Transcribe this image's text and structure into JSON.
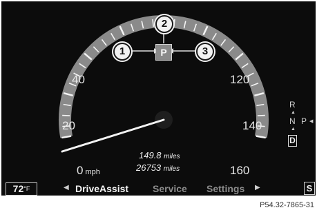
{
  "speedometer": {
    "labels": {
      "s0": "0",
      "s20": "20",
      "s40": "40",
      "s120": "120",
      "s140": "140",
      "s160": "160"
    },
    "unit": "mph",
    "needle_speed_mph": 2
  },
  "trip": {
    "trip_value": "149.8",
    "trip_unit": "miles",
    "odometer_value": "26753",
    "odometer_unit": "miles"
  },
  "park_indicator": {
    "label": "P"
  },
  "callouts": [
    "1",
    "2",
    "3"
  ],
  "transmission": {
    "r": "R",
    "n": "N",
    "p": "P",
    "d": "D"
  },
  "bottom_bar": {
    "temperature": "72",
    "temperature_unit": "°F",
    "menu": [
      "DriveAssist",
      "Service",
      "Settings"
    ],
    "s_label": "S"
  },
  "figure_code": "P54.32-7865-31",
  "colors": {
    "background": "#0c0c0c",
    "arc": "#8a8a8a",
    "text": "#e8e8e8",
    "inactive": "#8c8c8c"
  }
}
